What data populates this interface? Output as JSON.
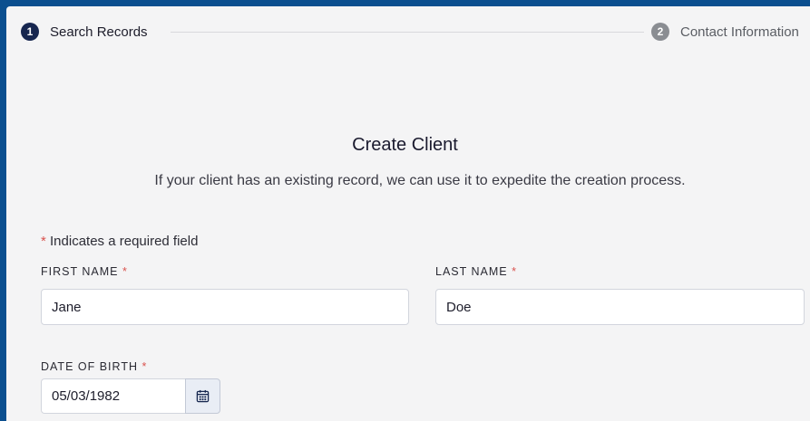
{
  "stepper": {
    "steps": [
      {
        "number": "1",
        "label": "Search Records"
      },
      {
        "number": "2",
        "label": "Contact Information"
      }
    ]
  },
  "form": {
    "title": "Create Client",
    "subtitle": "If your client has an existing record, we can use it to expedite the creation process.",
    "required_asterisk": "*",
    "required_note": "Indicates a required field",
    "first_name": {
      "label": "FIRST NAME",
      "value": "Jane"
    },
    "last_name": {
      "label": "LAST NAME",
      "value": "Doe"
    },
    "date_of_birth": {
      "label": "DATE OF BIRTH",
      "value": "05/03/1982"
    }
  },
  "icons": {
    "calendar": "calendar-icon"
  },
  "colors": {
    "frame_border": "#0b4f8f",
    "step_active": "#16264f",
    "step_inactive": "#8a8d92",
    "required": "#d9534f"
  }
}
